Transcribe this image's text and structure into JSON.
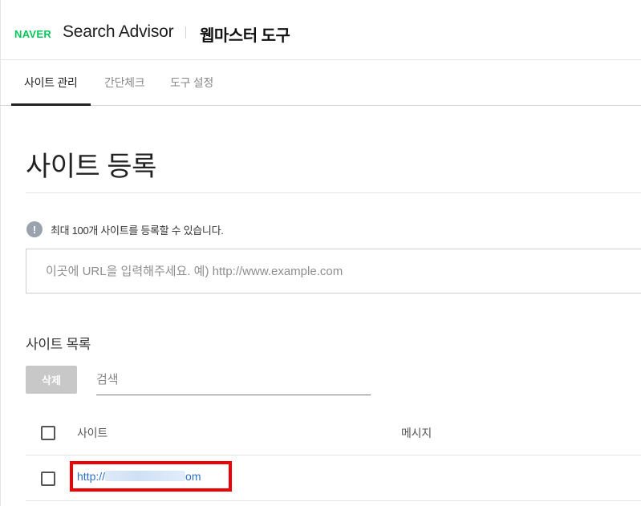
{
  "header": {
    "logo": "NAVER",
    "brand_title": "Search Advisor",
    "tool_title": "웹마스터 도구"
  },
  "tabs": [
    {
      "label": "사이트 관리",
      "active": true
    },
    {
      "label": "간단체크",
      "active": false
    },
    {
      "label": "도구 설정",
      "active": false
    }
  ],
  "page": {
    "title": "사이트 등록",
    "info_text": "최대 100개 사이트를 등록할 수 있습니다.",
    "url_placeholder": "이곳에 URL을 입력해주세요. 예) http://www.example.com"
  },
  "site_list": {
    "title": "사이트 목록",
    "delete_label": "삭제",
    "search_placeholder": "검색",
    "columns": {
      "site": "사이트",
      "message": "메시지"
    },
    "rows": [
      {
        "site_prefix": "http://",
        "site_suffix": "om",
        "message": ""
      }
    ]
  },
  "icons": {
    "info": "info-icon"
  },
  "colors": {
    "naver_green": "#03c75a",
    "link_blue": "#2b6fc7",
    "highlight_red": "#ee0000",
    "disabled_button": "#c8c8c8"
  }
}
